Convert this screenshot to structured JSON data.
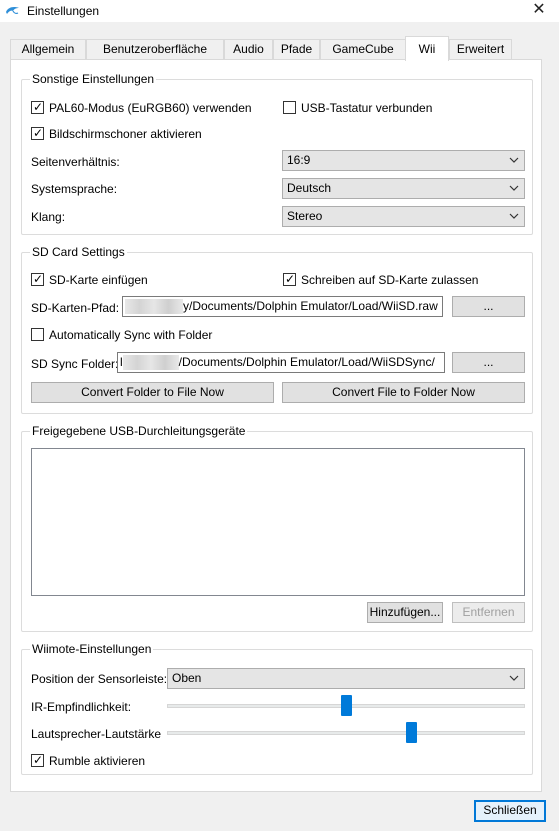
{
  "window": {
    "title": "Einstellungen",
    "close_glyph": "✕",
    "icon": "dolphin-icon"
  },
  "tabs": [
    {
      "label": "Allgemein",
      "active": false
    },
    {
      "label": "Benutzeroberfläche",
      "active": false
    },
    {
      "label": "Audio",
      "active": false
    },
    {
      "label": "Pfade",
      "active": false
    },
    {
      "label": "GameCube",
      "active": false
    },
    {
      "label": "Wii",
      "active": true
    },
    {
      "label": "Erweitert",
      "active": false
    }
  ],
  "misc": {
    "title": "Sonstige Einstellungen",
    "pal60": {
      "label": "PAL60-Modus (EuRGB60) verwenden",
      "checked": true
    },
    "usb_keyboard": {
      "label": "USB-Tastatur verbunden",
      "checked": false
    },
    "screensaver": {
      "label": "Bildschirmschoner aktivieren",
      "checked": true
    },
    "aspect_label": "Seitenverhältnis:",
    "aspect_value": "16:9",
    "language_label": "Systemsprache:",
    "language_value": "Deutsch",
    "sound_label": "Klang:",
    "sound_value": "Stereo"
  },
  "sd": {
    "title": "SD Card Settings",
    "insert": {
      "label": "SD-Karte einfügen",
      "checked": true
    },
    "allow_write": {
      "label": "Schreiben auf SD-Karte zulassen",
      "checked": true
    },
    "path_label": "SD-Karten-Pfad:",
    "path_value": "y/Documents/Dolphin Emulator/Load/WiiSD.raw",
    "path_browse": "...",
    "autosync": {
      "label": "Automatically Sync with Folder",
      "checked": false
    },
    "sync_label": "SD Sync Folder:",
    "sync_value": "/Documents/Dolphin Emulator/Load/WiiSDSync/",
    "sync_prefix": "l",
    "sync_browse": "...",
    "convert_to_file": "Convert Folder to File Now",
    "convert_to_folder": "Convert File to Folder Now"
  },
  "usb": {
    "title": "Freigegebene USB-Durchleitungsgeräte",
    "add_label": "Hinzufügen...",
    "remove_label": "Entfernen"
  },
  "wiimote": {
    "title": "Wiimote-Einstellungen",
    "sensor_label": "Position der Sensorleiste:",
    "sensor_value": "Oben",
    "ir_label": "IR-Empfindlichkeit:",
    "ir_level": 0.5,
    "speaker_label": "Lautsprecher-Lautstärke",
    "speaker_level": 0.69,
    "rumble": {
      "label": "Rumble aktivieren",
      "checked": true
    }
  },
  "footer": {
    "close_label": "Schließen"
  },
  "colors": {
    "accent": "#0078d7",
    "slider": "#007ad9"
  }
}
